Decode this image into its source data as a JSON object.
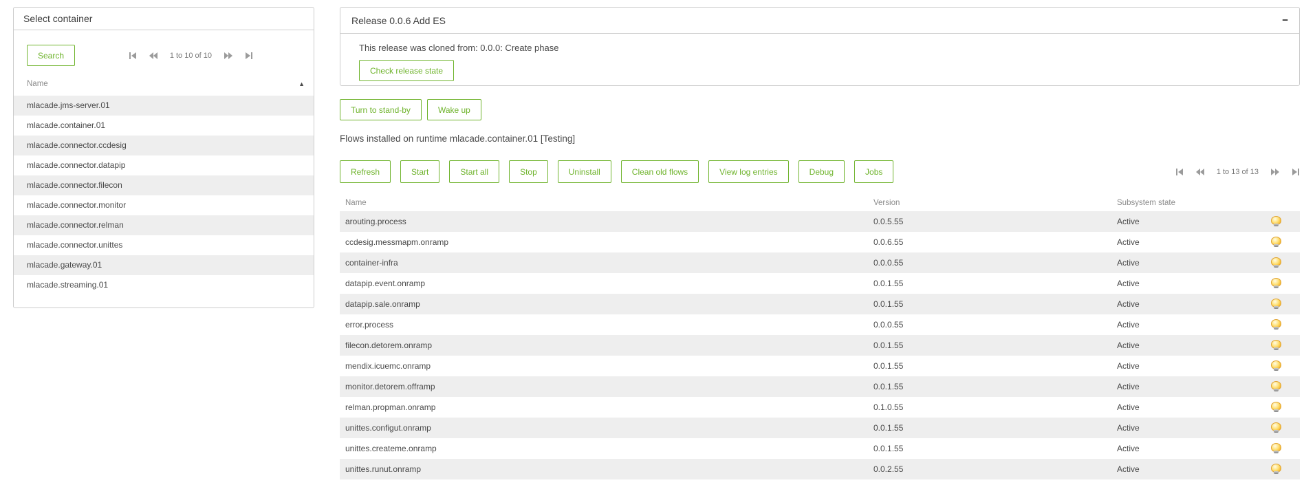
{
  "colors": {
    "accent": "#6eb32b",
    "stripe": "#eeeeee",
    "border": "#cccccc",
    "text": "#4a4a4a",
    "muted": "#8b8b8b",
    "pager_icon": "#9b9b9b",
    "bulb": "#f5b325"
  },
  "left_panel": {
    "title": "Select container",
    "search_label": "Search",
    "pagination_text": "1 to 10 of 10",
    "name_header": "Name",
    "sort_indicator": "▲",
    "items": [
      "mlacade.jms-server.01",
      "mlacade.container.01",
      "mlacade.connector.ccdesig",
      "mlacade.connector.datapip",
      "mlacade.connector.filecon",
      "mlacade.connector.monitor",
      "mlacade.connector.relman",
      "mlacade.connector.unittes",
      "mlacade.gateway.01",
      "mlacade.streaming.01"
    ]
  },
  "release_panel": {
    "title": "Release 0.0.6 Add ES",
    "collapse_label": "−",
    "cloned_text": "This release was cloned from: 0.0.0: Create phase",
    "check_button": "Check release state"
  },
  "actions": {
    "standby_button": "Turn to stand-by",
    "wakeup_button": "Wake up"
  },
  "flows": {
    "heading": "Flows installed on runtime mlacade.container.01 [Testing]",
    "toolbar": [
      "Refresh",
      "Start",
      "Start all",
      "Stop",
      "Uninstall",
      "Clean old flows",
      "View log entries",
      "Debug",
      "Jobs"
    ],
    "pagination_text": "1 to 13 of 13",
    "columns": [
      "Name",
      "Version",
      "Subsystem state"
    ],
    "rows": [
      {
        "name": "arouting.process",
        "version": "0.0.5.55",
        "state": "Active"
      },
      {
        "name": "ccdesig.messmapm.onramp",
        "version": "0.0.6.55",
        "state": "Active"
      },
      {
        "name": "container-infra",
        "version": "0.0.0.55",
        "state": "Active"
      },
      {
        "name": "datapip.event.onramp",
        "version": "0.0.1.55",
        "state": "Active"
      },
      {
        "name": "datapip.sale.onramp",
        "version": "0.0.1.55",
        "state": "Active"
      },
      {
        "name": "error.process",
        "version": "0.0.0.55",
        "state": "Active"
      },
      {
        "name": "filecon.detorem.onramp",
        "version": "0.0.1.55",
        "state": "Active"
      },
      {
        "name": "mendix.icuemc.onramp",
        "version": "0.0.1.55",
        "state": "Active"
      },
      {
        "name": "monitor.detorem.offramp",
        "version": "0.0.1.55",
        "state": "Active"
      },
      {
        "name": "relman.propman.onramp",
        "version": "0.1.0.55",
        "state": "Active"
      },
      {
        "name": "unittes.configut.onramp",
        "version": "0.0.1.55",
        "state": "Active"
      },
      {
        "name": "unittes.createme.onramp",
        "version": "0.0.1.55",
        "state": "Active"
      },
      {
        "name": "unittes.runut.onramp",
        "version": "0.0.2.55",
        "state": "Active"
      }
    ]
  }
}
